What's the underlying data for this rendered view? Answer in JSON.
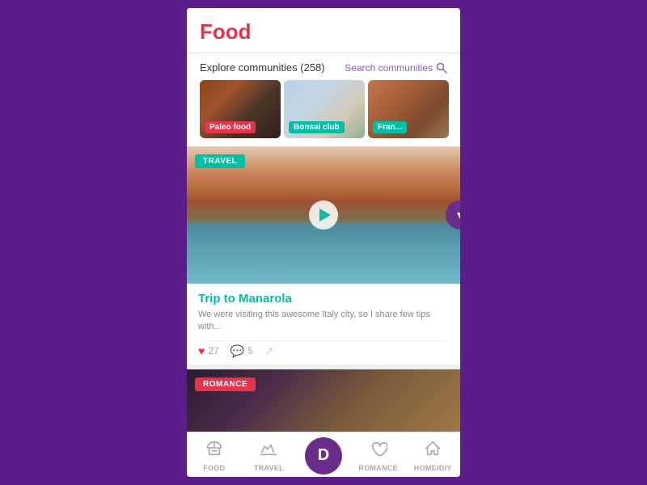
{
  "page": {
    "title": "Food"
  },
  "header": {
    "title": "Food"
  },
  "explore": {
    "title": "Explore communities (258)",
    "count": "258",
    "search_label": "Search communities",
    "communities": [
      {
        "id": "paleo",
        "label": "Paleo food",
        "label_color": "red"
      },
      {
        "id": "bonsai",
        "label": "Bonsai club",
        "label_color": "teal"
      },
      {
        "id": "france",
        "label": "Fran...",
        "label_color": "teal"
      }
    ]
  },
  "feed": {
    "posts": [
      {
        "id": "trip-manarola",
        "tag": "TRAVEL",
        "tag_color": "teal",
        "title": "Trip to Manarola",
        "excerpt": "We were visiting this awesome Italy city, so I share few tips with...",
        "likes": "27",
        "comments": "5",
        "has_video": true
      },
      {
        "id": "romance-post",
        "tag": "ROMANCE",
        "tag_color": "red",
        "title": "",
        "excerpt": "",
        "likes": "",
        "comments": "",
        "has_video": false
      }
    ]
  },
  "bottom_nav": {
    "items": [
      {
        "id": "food",
        "label": "FOOD",
        "icon": "food"
      },
      {
        "id": "travel",
        "label": "TRAVEL",
        "icon": "travel"
      },
      {
        "id": "center",
        "label": "",
        "icon": "D",
        "is_center": true
      },
      {
        "id": "romance",
        "label": "ROMANCE",
        "icon": "romance"
      },
      {
        "id": "home-diy",
        "label": "HOME/DIY",
        "icon": "home"
      }
    ],
    "center_letter": "D"
  }
}
